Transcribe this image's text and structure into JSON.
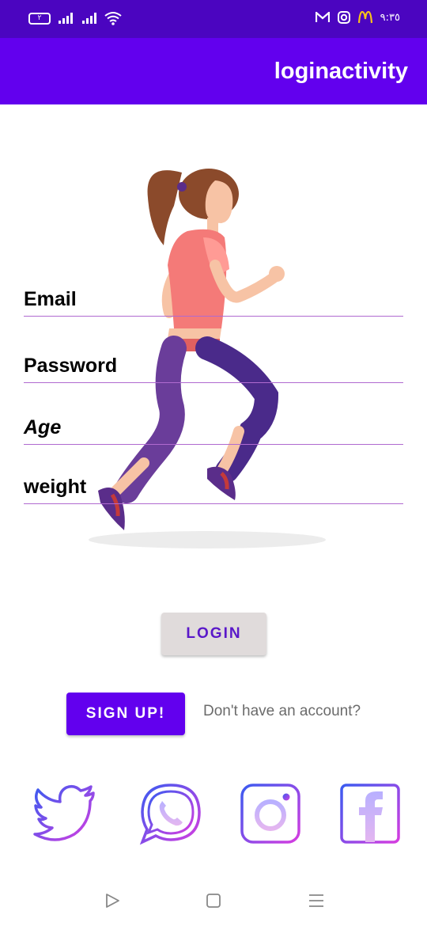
{
  "status_bar": {
    "time": "٩:٣٥",
    "battery_label": "٢",
    "notifications": [
      "gmail-icon",
      "instagram-icon",
      "mcdonalds-icon"
    ]
  },
  "app_bar": {
    "title": "loginactivity"
  },
  "form": {
    "email_hint": "Email",
    "password_hint": "Password",
    "age_hint": "Age",
    "weight_hint": "weight"
  },
  "buttons": {
    "login_label": "LOGIN",
    "signup_label": "SIGN UP!",
    "signup_hint": "Don't have an account?"
  },
  "social": [
    "twitter-icon",
    "whatsapp-icon",
    "instagram-icon",
    "facebook-icon"
  ],
  "colors": {
    "accent": "#6200ee",
    "status_bar": "#4b05c0",
    "field_underline": "#b06ad0",
    "login_text": "#5a18c9"
  }
}
